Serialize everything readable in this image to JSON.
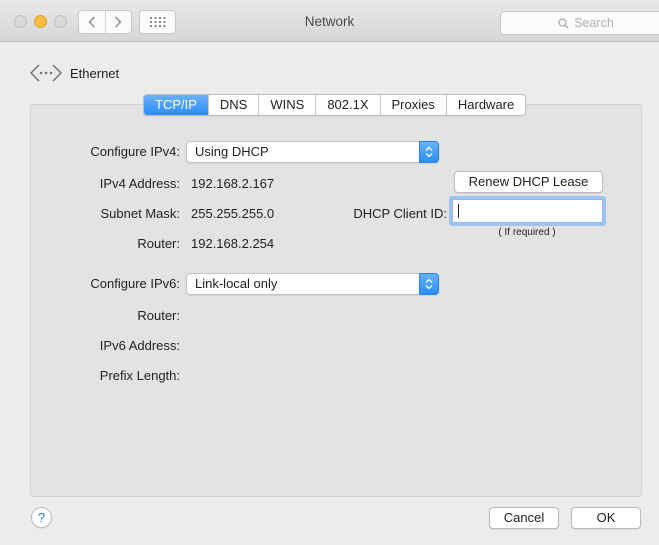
{
  "window": {
    "title": "Network"
  },
  "search": {
    "placeholder": "Search"
  },
  "interface": {
    "name": "Ethernet"
  },
  "tabs": [
    {
      "label": "TCP/IP",
      "active": true
    },
    {
      "label": "DNS"
    },
    {
      "label": "WINS"
    },
    {
      "label": "802.1X"
    },
    {
      "label": "Proxies"
    },
    {
      "label": "Hardware"
    }
  ],
  "ipv4": {
    "configure_label": "Configure IPv4:",
    "configure_value": "Using DHCP",
    "address_label": "IPv4 Address:",
    "address_value": "192.168.2.167",
    "subnet_label": "Subnet Mask:",
    "subnet_value": "255.255.255.0",
    "router_label": "Router:",
    "router_value": "192.168.2.254"
  },
  "dhcp": {
    "renew_label": "Renew DHCP Lease",
    "client_id_label": "DHCP Client ID:",
    "client_id_value": "",
    "hint": "( If required )"
  },
  "ipv6": {
    "configure_label": "Configure IPv6:",
    "configure_value": "Link-local only",
    "router_label": "Router:",
    "address_label": "IPv6 Address:",
    "prefix_label": "Prefix Length:"
  },
  "footer": {
    "help": "?",
    "cancel_label": "Cancel",
    "ok_label": "OK"
  },
  "colors": {
    "accent": "#2c8ef8",
    "minimize": "#f6bd42"
  },
  "icons": [
    "back-chevron-icon",
    "forward-chevron-icon",
    "grid-icon",
    "search-icon",
    "ethernet-icon",
    "popup-arrows-icon"
  ]
}
